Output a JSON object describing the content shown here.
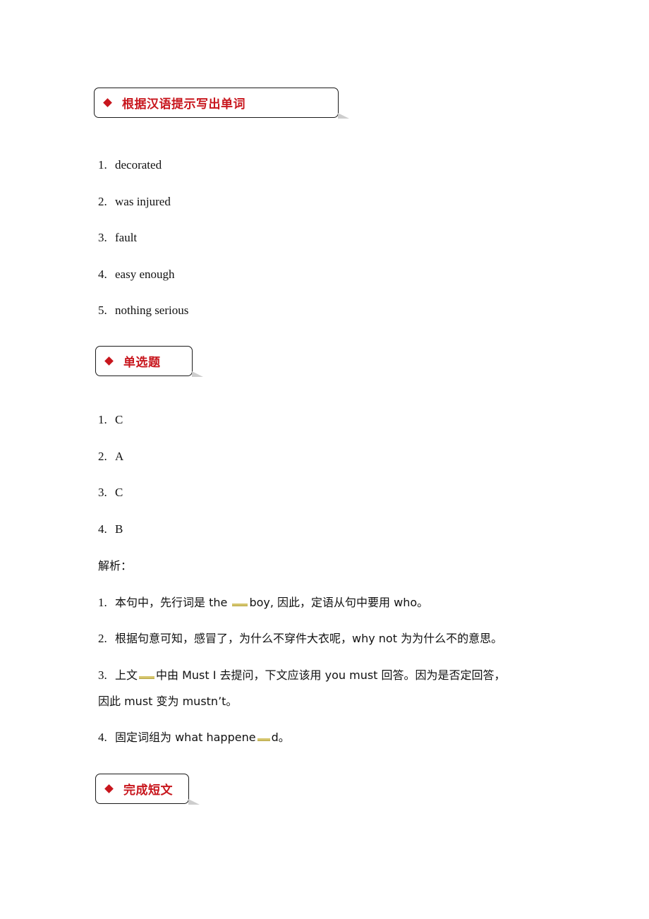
{
  "sections": [
    {
      "title": "根据汉语提示写出单词"
    },
    {
      "title": "单选题"
    },
    {
      "title": "完成短文"
    }
  ],
  "vocab_answers": [
    {
      "num": "1.",
      "text": "decorated"
    },
    {
      "num": "2.",
      "text": "was injured"
    },
    {
      "num": "3.",
      "text": "fault"
    },
    {
      "num": "4.",
      "text": "easy enough"
    },
    {
      "num": "5.",
      "text": "nothing serious"
    }
  ],
  "choice_answers": [
    {
      "num": "1.",
      "text": "C"
    },
    {
      "num": "2.",
      "text": "A"
    },
    {
      "num": "3.",
      "text": "C"
    },
    {
      "num": "4.",
      "text": "B"
    }
  ],
  "analysis_label": "解析：",
  "analysis": [
    {
      "num": "1.",
      "a": "本句中，先行词是 the ",
      "b": "boy, 因此，定语从句中要用 who。"
    },
    {
      "num": "2.",
      "a": "根据句意可知，感冒了，为什么不穿件大衣呢，why not 为为什么不的意思。"
    },
    {
      "num": "3.",
      "a": "上文",
      "b": "中由 Must I  去提问，下文应该用 you must  回答。因为是否定回答，",
      "c": "因此 must 变为 mustn’t。"
    },
    {
      "num": "4.",
      "a": "固定词组为 what happene",
      "b": "d。"
    }
  ],
  "colors": {
    "accent": "#c8161d",
    "blank_highlight": "#d4c46a"
  }
}
